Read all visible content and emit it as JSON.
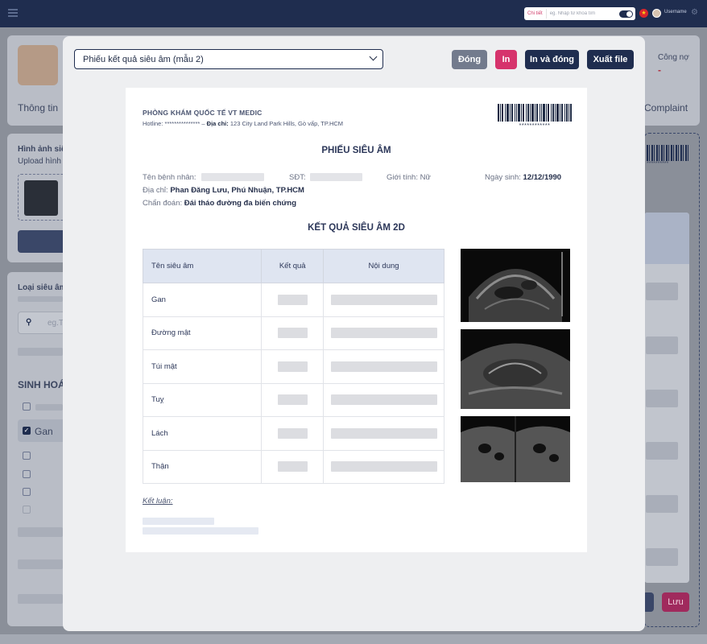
{
  "topbar": {
    "chitiet_label": "Chi tiết",
    "search_placeholder": "eg. Nhập từ khoá tìm",
    "username": "Username"
  },
  "background": {
    "cong_no": "Công nợ",
    "cong_no_value": "-",
    "tab_thong_tin": "Thông tin",
    "tab_complaint": "Complaint",
    "hinh_anh_label": "Hình ảnh siê",
    "upload_label": "Upload hình",
    "loai_sieu_am": "Loại siêu âm",
    "search_placeholder": "eg.T",
    "sinh_hoa": "SINH HOÁ",
    "gan_item": "Gan",
    "luu_button": "Lưu",
    "barcode_text": "**********"
  },
  "modal": {
    "template_select": "Phiếu kết quả siêu âm (mẫu 2)",
    "buttons": {
      "dong": "Đóng",
      "in": "In",
      "in_va_dong": "In và đóng",
      "xuat_file": "Xuất file"
    },
    "colors": {
      "dong": "#737b8d",
      "in": "#d6336c",
      "primary": "#1f2d4f"
    }
  },
  "document": {
    "clinic_name": "PHÒNG KHÁM QUỐC TẾ VT MEDIC",
    "hotline_label": "Hotline:",
    "hotline_value": "***************",
    "address_label": "Địa chỉ:",
    "address_value": "123 City Land Park Hills, Gò vấp, TP.HCM",
    "barcode_text": "************",
    "title": "PHIẾU SIÊU ÂM",
    "patient_label": "Tên bệnh nhân:",
    "phone_label": "SĐT:",
    "gender_label": "Giới tính:",
    "gender_value": "Nữ",
    "dob_label": "Ngày sinh:",
    "dob_value": "12/12/1990",
    "address2_label": "Địa chỉ:",
    "address2_value": "Phan Đăng Lưu, Phú Nhuận, TP.HCM",
    "diagnosis_label": "Chẩn đoán:",
    "diagnosis_value": "Đái tháo đường đa biến chứng",
    "section_title": "KẾT QUẢ SIÊU ÂM 2D",
    "table": {
      "headers": [
        "Tên siêu âm",
        "Kết quả",
        "Nội dung"
      ],
      "rows": [
        "Gan",
        "Đường mật",
        "Túi mật",
        "Tuỵ",
        "Lách",
        "Thận"
      ]
    },
    "conclusion_label": "Kết luận:"
  }
}
